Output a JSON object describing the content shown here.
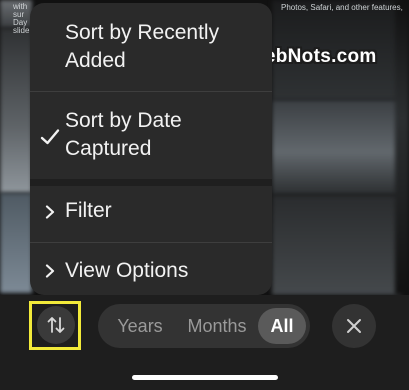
{
  "background": {
    "partial_text_right": "Photos, Safari, and other features,",
    "partial_text_left": "with sur Day slide"
  },
  "watermark": "WebNots.com",
  "menu": {
    "items": [
      {
        "label": "Sort by Recently Added",
        "checked": false,
        "icon": null
      },
      {
        "label": "Sort by Date Captured",
        "checked": true,
        "icon": "checkmark-icon"
      },
      {
        "label": "Filter",
        "checked": false,
        "icon": "chevron-right-icon"
      },
      {
        "label": "View Options",
        "checked": false,
        "icon": "chevron-right-icon"
      }
    ]
  },
  "toolbar": {
    "sort_icon": "sort-arrows-icon",
    "segments": [
      {
        "label": "Years",
        "selected": false
      },
      {
        "label": "Months",
        "selected": false
      },
      {
        "label": "All",
        "selected": true
      }
    ],
    "close_icon": "close-icon"
  },
  "colors": {
    "menu_bg": "#2a2a2a",
    "highlight_box": "#f2ea3a",
    "selected_segment": "#5a5a5a"
  }
}
